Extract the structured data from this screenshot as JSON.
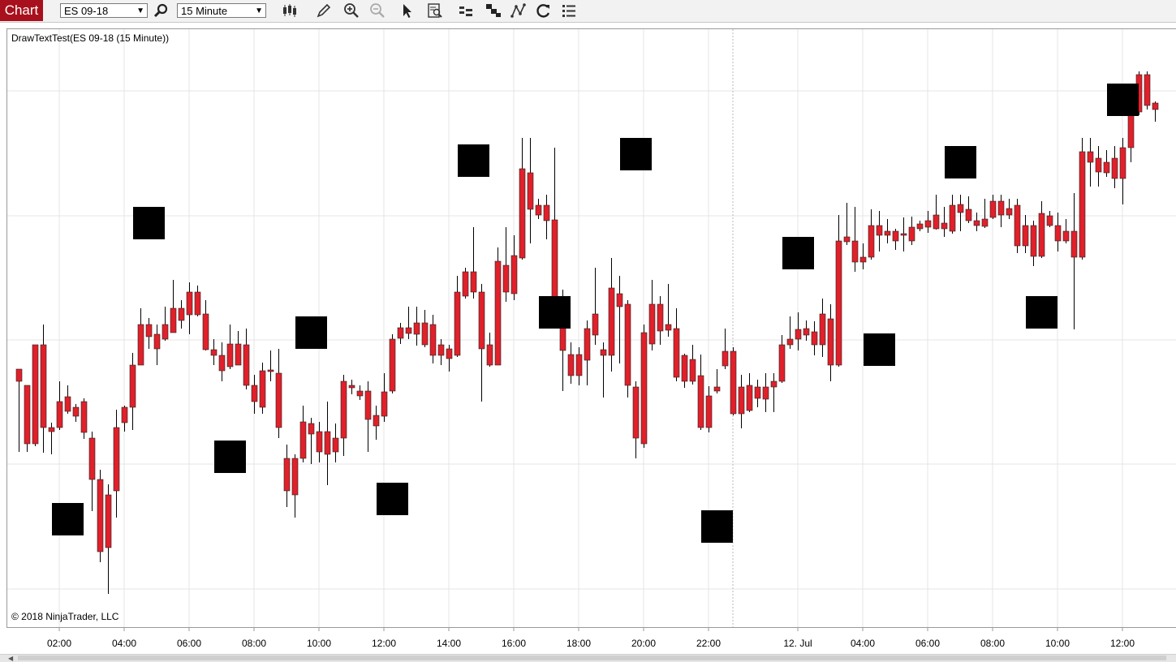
{
  "toolbar": {
    "chart_tab": "Chart",
    "instrument": "ES 09-18",
    "interval": "15 Minute",
    "icons": [
      "search-icon",
      "bar-type-icon",
      "pencil-icon",
      "zoom-in-icon",
      "zoom-out-icon",
      "pointer-icon",
      "data-box-icon",
      "strategies-icon",
      "indicators-icon",
      "chart-trader-icon",
      "reload-icon",
      "properties-icon"
    ]
  },
  "chart": {
    "indicator_label": "DrawTextTest(ES 09-18 (15 Minute))",
    "copyright": "© 2018 NinjaTrader, LLC",
    "x_axis_labels": [
      "02:00",
      "04:00",
      "06:00",
      "08:00",
      "10:00",
      "12:00",
      "14:00",
      "16:00",
      "18:00",
      "20:00",
      "22:00",
      "12. Jul",
      "04:00",
      "06:00",
      "08:00",
      "10:00",
      "12:00"
    ],
    "colors": {
      "up": "#3cb64a",
      "down": "#e0202a",
      "wick": "#000000",
      "square": "#000000",
      "grid": "#e4e4e4"
    }
  },
  "chart_data": {
    "type": "candlestick",
    "bars": [
      [
        455,
        470,
        458,
        557
      ],
      [
        475,
        547,
        475,
        557
      ],
      [
        425,
        547,
        425,
        550
      ],
      [
        425,
        527,
        400,
        558
      ],
      [
        527,
        532,
        521,
        560
      ],
      [
        495,
        527,
        470,
        530
      ],
      [
        489,
        507,
        475,
        510
      ],
      [
        502,
        513,
        498,
        520
      ],
      [
        495,
        533,
        491,
        541
      ],
      [
        540,
        591,
        532,
        630
      ],
      [
        591,
        680,
        579,
        693
      ],
      [
        610,
        675,
        597,
        732
      ],
      [
        527,
        605,
        505,
        638
      ],
      [
        502,
        521,
        500,
        532
      ],
      [
        450,
        502,
        435,
        530
      ],
      [
        400,
        450,
        380,
        450
      ],
      [
        400,
        415,
        392,
        430
      ],
      [
        412,
        430,
        400,
        450
      ],
      [
        400,
        418,
        378,
        420
      ],
      [
        380,
        410,
        345,
        410
      ],
      [
        380,
        395,
        370,
        405
      ],
      [
        360,
        388,
        348,
        412
      ],
      [
        360,
        388,
        352,
        390
      ],
      [
        387,
        431,
        370,
        432
      ],
      [
        431,
        438,
        418,
        450
      ],
      [
        438,
        457,
        422,
        470
      ],
      [
        424,
        452,
        400,
        455
      ],
      [
        424,
        450,
        408,
        448
      ],
      [
        425,
        475,
        405,
        480
      ],
      [
        475,
        495,
        462,
        510
      ],
      [
        457,
        502,
        447,
        510
      ],
      [
        456,
        458,
        432,
        470
      ],
      [
        460,
        527,
        430,
        540
      ],
      [
        565,
        605,
        548,
        625
      ],
      [
        565,
        610,
        560,
        638
      ],
      [
        520,
        565,
        500,
        570
      ],
      [
        522,
        535,
        515,
        572
      ],
      [
        532,
        557,
        520,
        570
      ],
      [
        532,
        560,
        495,
        598
      ],
      [
        540,
        557,
        522,
        570
      ],
      [
        470,
        540,
        462,
        562
      ],
      [
        475,
        478,
        468,
        486
      ],
      [
        482,
        488,
        475,
        493
      ],
      [
        482,
        517,
        470,
        557
      ],
      [
        512,
        525,
        500,
        542
      ],
      [
        483,
        513,
        460,
        520
      ],
      [
        418,
        482,
        412,
        485
      ],
      [
        404,
        417,
        398,
        424
      ],
      [
        404,
        411,
        378,
        418
      ],
      [
        398,
        412,
        378,
        426
      ],
      [
        398,
        425,
        382,
        428
      ],
      [
        400,
        438,
        388,
        448
      ],
      [
        425,
        438,
        418,
        450
      ],
      [
        430,
        442,
        425,
        458
      ],
      [
        360,
        438,
        340,
        440
      ],
      [
        335,
        365,
        330,
        368
      ],
      [
        335,
        360,
        280,
        368
      ],
      [
        360,
        430,
        350,
        495
      ],
      [
        425,
        450,
        410,
        452
      ],
      [
        322,
        450,
        305,
        450
      ],
      [
        327,
        360,
        280,
        372
      ],
      [
        315,
        362,
        290,
        370
      ],
      [
        208,
        318,
        170,
        320
      ],
      [
        213,
        258,
        170,
        300
      ],
      [
        253,
        265,
        245,
        270
      ],
      [
        253,
        272,
        240,
        295
      ],
      [
        271,
        390,
        182,
        400
      ],
      [
        388,
        432,
        357,
        482
      ],
      [
        437,
        463,
        422,
        473
      ],
      [
        437,
        463,
        428,
        475
      ],
      [
        405,
        444,
        395,
        475
      ],
      [
        387,
        413,
        330,
        425
      ],
      [
        431,
        438,
        422,
        490
      ],
      [
        355,
        438,
        318,
        458
      ],
      [
        362,
        378,
        340,
        448
      ],
      [
        375,
        475,
        370,
        490
      ],
      [
        477,
        540,
        470,
        565
      ],
      [
        410,
        547,
        400,
        552
      ],
      [
        375,
        424,
        345,
        432
      ],
      [
        375,
        408,
        365,
        425
      ],
      [
        400,
        407,
        350,
        415
      ],
      [
        405,
        465,
        380,
        470
      ],
      [
        438,
        470,
        436,
        478
      ],
      [
        443,
        470,
        425,
        474
      ],
      [
        463,
        527,
        437,
        530
      ],
      [
        488,
        527,
        476,
        533
      ],
      [
        477,
        482,
        455,
        485
      ],
      [
        433,
        451,
        405,
        455
      ],
      [
        433,
        510,
        428,
        512
      ],
      [
        477,
        510,
        462,
        528
      ],
      [
        475,
        506,
        460,
        508
      ],
      [
        477,
        491,
        468,
        502
      ],
      [
        477,
        492,
        460,
        508
      ],
      [
        470,
        477,
        460,
        508
      ],
      [
        425,
        470,
        413,
        472
      ],
      [
        418,
        425,
        390,
        430
      ],
      [
        406,
        418,
        385,
        432
      ],
      [
        405,
        413,
        395,
        420
      ],
      [
        409,
        425,
        396,
        438
      ],
      [
        387,
        425,
        368,
        440
      ],
      [
        393,
        450,
        375,
        470
      ],
      [
        297,
        450,
        265,
        452
      ],
      [
        292,
        298,
        250,
        302
      ],
      [
        297,
        323,
        255,
        335
      ],
      [
        317,
        323,
        300,
        332
      ],
      [
        278,
        317,
        258,
        320
      ],
      [
        278,
        290,
        260,
        310
      ],
      [
        285,
        290,
        270,
        300
      ],
      [
        285,
        297,
        282,
        308
      ],
      [
        288,
        290,
        268,
        310
      ],
      [
        280,
        297,
        267,
        302
      ],
      [
        276,
        282,
        272,
        285
      ],
      [
        272,
        280,
        260,
        287
      ],
      [
        265,
        282,
        240,
        283
      ],
      [
        275,
        282,
        255,
        292
      ],
      [
        253,
        285,
        240,
        288
      ],
      [
        252,
        262,
        240,
        285
      ],
      [
        258,
        272,
        242,
        275
      ],
      [
        272,
        278,
        262,
        285
      ],
      [
        270,
        279,
        245,
        281
      ],
      [
        248,
        268,
        240,
        270
      ],
      [
        248,
        265,
        240,
        280
      ],
      [
        257,
        265,
        245,
        270
      ],
      [
        253,
        303,
        245,
        312
      ],
      [
        278,
        303,
        265,
        312
      ],
      [
        278,
        316,
        272,
        328
      ],
      [
        263,
        316,
        248,
        318
      ],
      [
        266,
        278,
        260,
        280
      ],
      [
        278,
        297,
        262,
        310
      ],
      [
        285,
        297,
        270,
        300
      ],
      [
        285,
        317,
        238,
        406
      ],
      [
        187,
        317,
        170,
        320
      ],
      [
        187,
        200,
        170,
        230
      ],
      [
        195,
        212,
        180,
        230
      ],
      [
        200,
        213,
        185,
        218
      ],
      [
        195,
        220,
        180,
        232
      ],
      [
        182,
        220,
        170,
        252
      ],
      [
        137,
        182,
        130,
        200
      ],
      [
        92,
        138,
        88,
        142
      ],
      [
        92,
        130,
        88,
        135
      ],
      [
        127,
        135,
        125,
        150
      ]
    ]
  },
  "squares": [
    [
      83,
      640
    ],
    [
      183,
      275
    ],
    [
      283,
      563
    ],
    [
      383,
      410
    ],
    [
      483,
      615
    ],
    [
      583,
      198
    ],
    [
      683,
      385
    ],
    [
      783,
      190
    ],
    [
      883,
      649
    ],
    [
      983,
      312
    ],
    [
      1083,
      431
    ],
    [
      1183,
      200
    ],
    [
      1283,
      385
    ],
    [
      1383,
      123
    ]
  ]
}
